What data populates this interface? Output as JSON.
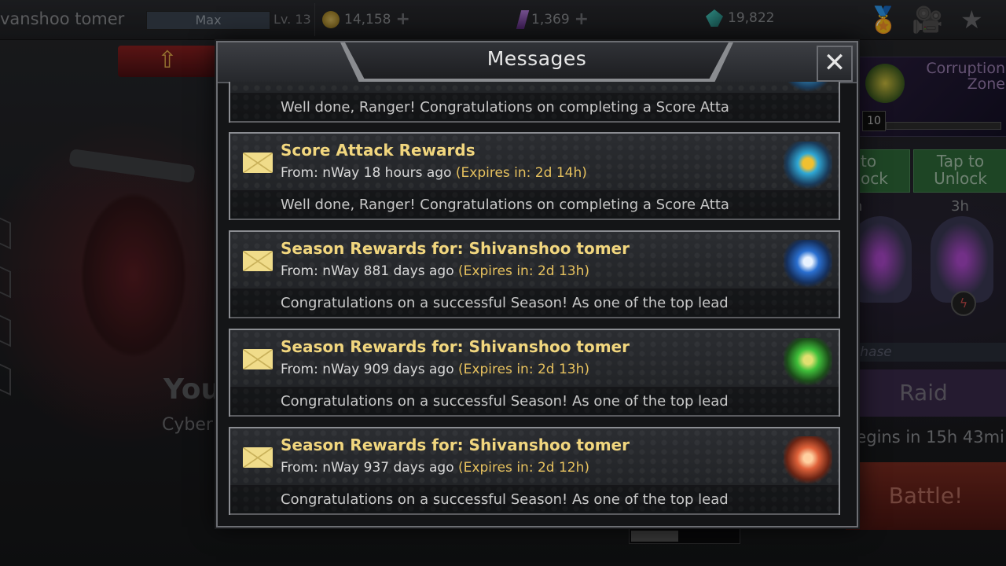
{
  "topbar": {
    "player_name": "vanshoo tomer",
    "xp_label": "Max",
    "level": "Lv. 13",
    "coins": "14,158",
    "crystals": "1,369",
    "shards": "19,822"
  },
  "background": {
    "you_text": "You",
    "cyber_text": "Cyber",
    "event_title": "Corruption Zone",
    "event_level": "10",
    "unlock_left": "to\nock",
    "unlock_right": "Tap to Unlock",
    "timer_left": "h",
    "timer_right": "3h",
    "phase_text": "Phase",
    "raid_label": "Raid",
    "raid_timer": "begins in 15h 43mi",
    "battle_label": "Battle!"
  },
  "dialog": {
    "title": "Messages",
    "close_symbol": "✕"
  },
  "messages": [
    {
      "title": "",
      "from": "",
      "expires": "",
      "preview": "Well done, Ranger! Congratulations on completing a Score Atta",
      "icon": "score-attack-reward-icon",
      "color": "#3aa0d8"
    },
    {
      "title": "Score Attack Rewards",
      "from": "From: nWay 18 hours ago",
      "expires": "(Expires in: 2d 14h)",
      "preview": "Well done, Ranger! Congratulations on completing a Score Atta",
      "icon": "score-attack-reward-icon",
      "color": "#2fa8d6"
    },
    {
      "title": "Season Rewards for: Shivanshoo tomer",
      "from": "From: nWay 881 days ago",
      "expires": "(Expires in: 2d 13h)",
      "preview": "Congratulations on a successful Season! As one of the top lead",
      "icon": "season-reward-blue-icon",
      "color": "#2a6fd0"
    },
    {
      "title": "Season Rewards for: Shivanshoo tomer",
      "from": "From: nWay 909 days ago",
      "expires": "(Expires in: 2d 13h)",
      "preview": "Congratulations on a successful Season! As one of the top lead",
      "icon": "season-reward-green-icon",
      "color": "#3fbf3a"
    },
    {
      "title": "Season Rewards for: Shivanshoo tomer",
      "from": "From: nWay 937 days ago",
      "expires": "(Expires in: 2d 12h)",
      "preview": "Congratulations on a successful Season! As one of the top lead",
      "icon": "season-reward-orange-icon",
      "color": "#e0623a"
    }
  ]
}
